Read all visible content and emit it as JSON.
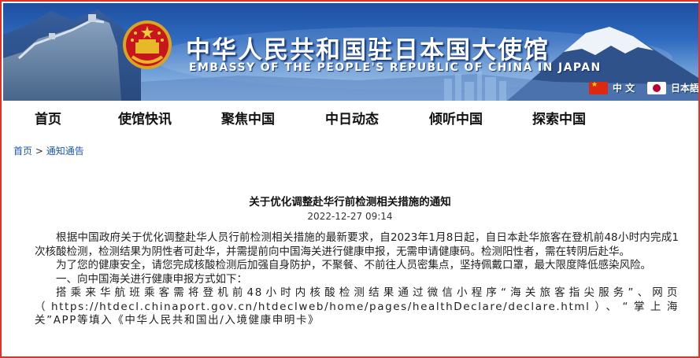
{
  "header": {
    "title_cn": "中华人民共和国驻日本国大使馆",
    "title_en": "EMBASSY OF THE PEOPLE'S REPUBLIC OF CHINA IN JAPAN",
    "languages": [
      {
        "label": "中 文",
        "flag_icon": "china-flag-icon"
      },
      {
        "label": "日本語",
        "flag_icon": "japan-flag-icon"
      }
    ]
  },
  "nav": {
    "items": [
      "首页",
      "使馆快讯",
      "聚焦中国",
      "中日动态",
      "倾听中国",
      "探索中国"
    ]
  },
  "breadcrumb": {
    "home": "首页",
    "separator": ">",
    "current": "通知通告"
  },
  "article": {
    "title": "关于优化调整赴华行前检测相关措施的通知",
    "date": "2022-12-27 09:14",
    "paragraphs": [
      "根据中国政府关于优化调整赴华人员行前检测相关措施的最新要求，自2023年1月8日起，自日本赴华旅客在登机前48小时内完成1次核酸检测，检测结果为阴性者可赴华，并需提前向中国海关进行健康申报，无需申请健康码。检测阳性者，需在转阴后赴华。",
      "为了您的健康安全，请您完成核酸检测后加强自身防护，不聚餐、不前往人员密集点，坚持佩戴口罩，最大限度降低感染风险。",
      "一、向中国海关进行健康申报方式如下：",
      "搭乘来华航班乘客需将登机前48小时内核酸检测结果通过微信小程序“海关旅客指尖服务”、网页（https://htdecl.chinaport.gov.cn/htdeclweb/home/pages/healthDeclare/declare.html）、“掌上海关”APP等填入《中华人民共和国出/入境健康申明卡》"
    ]
  },
  "colors": {
    "frame_border": "#e0322b",
    "banner_blue": "#2f6bc0",
    "link_blue": "#1a56b6"
  }
}
